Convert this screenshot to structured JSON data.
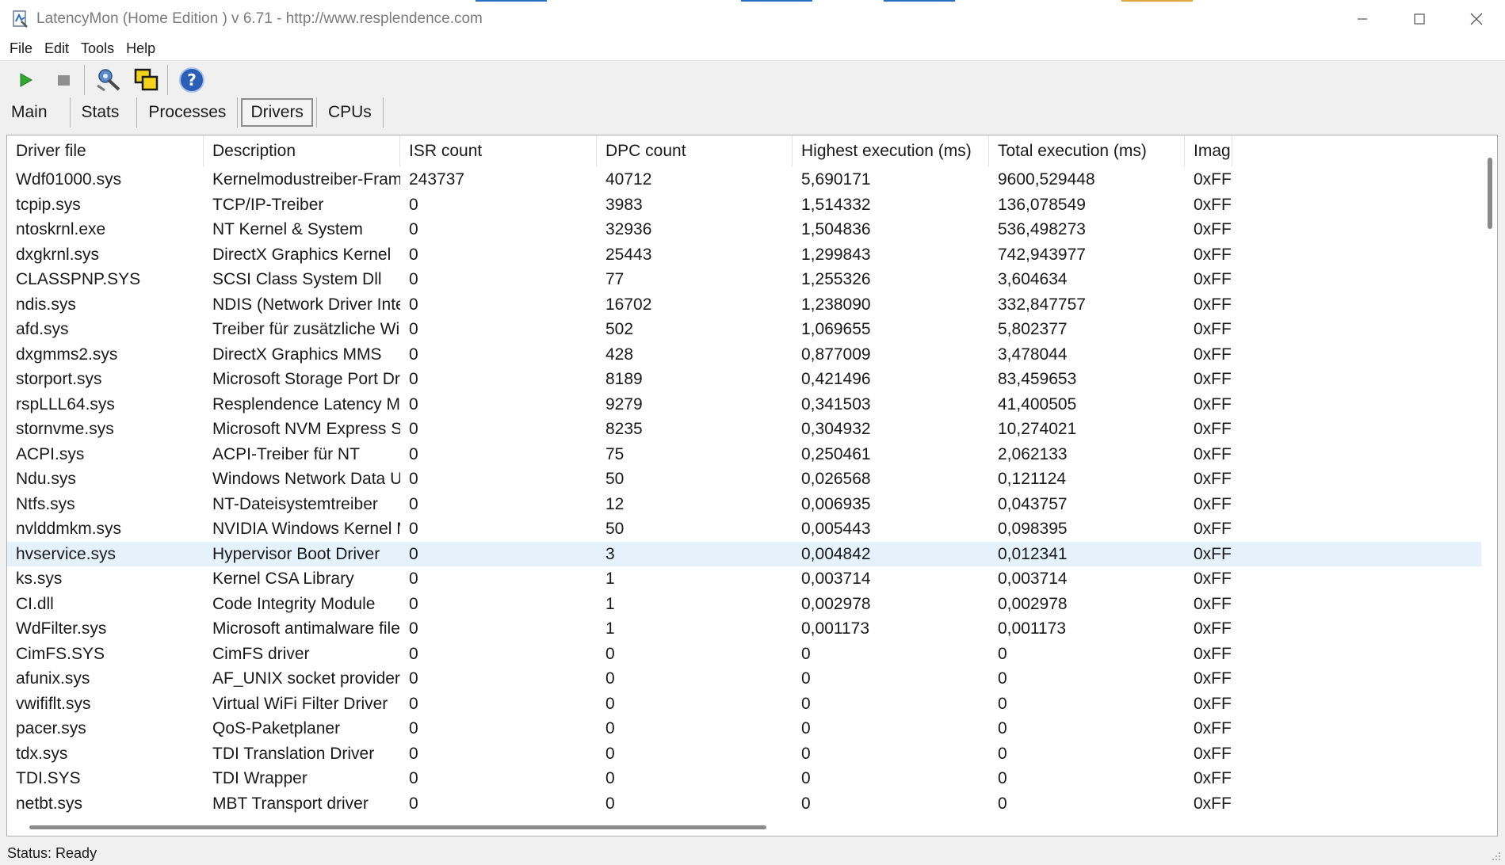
{
  "window": {
    "title": "LatencyMon  (Home Edition )  v 6.71 - http://www.resplendence.com"
  },
  "menu": [
    {
      "label": "File"
    },
    {
      "label": "Edit"
    },
    {
      "label": "Tools"
    },
    {
      "label": "Help"
    }
  ],
  "toolbar": {
    "buttons": [
      "play-icon",
      "stop-icon",
      "settings-wrench-icon",
      "window-overlap-icon",
      "help-icon"
    ]
  },
  "tabs": [
    {
      "label": "Main",
      "active": false
    },
    {
      "label": "Stats",
      "active": false
    },
    {
      "label": "Processes",
      "active": false
    },
    {
      "label": "Drivers",
      "active": true
    },
    {
      "label": "CPUs",
      "active": false
    }
  ],
  "table": {
    "columns": [
      "Driver file",
      "Description",
      "ISR count",
      "DPC count",
      "Highest execution (ms)",
      "Total execution (ms)",
      "Imag"
    ],
    "rows": [
      [
        "Wdf01000.sys",
        "Kernelmodustreiber-Framew...",
        "243737",
        "40712",
        "5,690171",
        "9600,529448",
        "0xFF"
      ],
      [
        "tcpip.sys",
        "TCP/IP-Treiber",
        "0",
        "3983",
        "1,514332",
        "136,078549",
        "0xFF"
      ],
      [
        "ntoskrnl.exe",
        "NT Kernel & System",
        "0",
        "32936",
        "1,504836",
        "536,498273",
        "0xFF"
      ],
      [
        "dxgkrnl.sys",
        "DirectX Graphics Kernel",
        "0",
        "25443",
        "1,299843",
        "742,943977",
        "0xFF"
      ],
      [
        "CLASSPNP.SYS",
        "SCSI Class System Dll",
        "0",
        "77",
        "1,255326",
        "3,604634",
        "0xFF"
      ],
      [
        "ndis.sys",
        "NDIS (Network Driver Interf...",
        "0",
        "16702",
        "1,238090",
        "332,847757",
        "0xFF"
      ],
      [
        "afd.sys",
        "Treiber für zusätzliche WinS...",
        "0",
        "502",
        "1,069655",
        "5,802377",
        "0xFF"
      ],
      [
        "dxgmms2.sys",
        "DirectX Graphics MMS",
        "0",
        "428",
        "0,877009",
        "3,478044",
        "0xFF"
      ],
      [
        "storport.sys",
        "Microsoft Storage Port Driver",
        "0",
        "8189",
        "0,421496",
        "83,459653",
        "0xFF"
      ],
      [
        "rspLLL64.sys",
        "Resplendence Latency Monit...",
        "0",
        "9279",
        "0,341503",
        "41,400505",
        "0xFF"
      ],
      [
        "stornvme.sys",
        "Microsoft NVM Express Stor...",
        "0",
        "8235",
        "0,304932",
        "10,274021",
        "0xFF"
      ],
      [
        "ACPI.sys",
        "ACPI-Treiber für NT",
        "0",
        "75",
        "0,250461",
        "2,062133",
        "0xFF"
      ],
      [
        "Ndu.sys",
        "Windows Network Data Usa...",
        "0",
        "50",
        "0,026568",
        "0,121124",
        "0xFF"
      ],
      [
        "Ntfs.sys",
        "NT-Dateisystemtreiber",
        "0",
        "12",
        "0,006935",
        "0,043757",
        "0xFF"
      ],
      [
        "nvlddmkm.sys",
        "NVIDIA Windows Kernel Mod...",
        "0",
        "50",
        "0,005443",
        "0,098395",
        "0xFF"
      ],
      [
        "hvservice.sys",
        "Hypervisor Boot Driver",
        "0",
        "3",
        "0,004842",
        "0,012341",
        "0xFF"
      ],
      [
        "ks.sys",
        "Kernel CSA Library",
        "0",
        "1",
        "0,003714",
        "0,003714",
        "0xFF"
      ],
      [
        "CI.dll",
        "Code Integrity Module",
        "0",
        "1",
        "0,002978",
        "0,002978",
        "0xFF"
      ],
      [
        "WdFilter.sys",
        "Microsoft antimalware file sys...",
        "0",
        "1",
        "0,001173",
        "0,001173",
        "0xFF"
      ],
      [
        "CimFS.SYS",
        "CimFS driver",
        "0",
        "0",
        "0",
        "0",
        "0xFF"
      ],
      [
        "afunix.sys",
        "AF_UNIX socket provider",
        "0",
        "0",
        "0",
        "0",
        "0xFF"
      ],
      [
        "vwififlt.sys",
        "Virtual WiFi Filter Driver",
        "0",
        "0",
        "0",
        "0",
        "0xFF"
      ],
      [
        "pacer.sys",
        "QoS-Paketplaner",
        "0",
        "0",
        "0",
        "0",
        "0xFF"
      ],
      [
        "tdx.sys",
        "TDI Translation Driver",
        "0",
        "0",
        "0",
        "0",
        "0xFF"
      ],
      [
        "TDI.SYS",
        "TDI Wrapper",
        "0",
        "0",
        "0",
        "0",
        "0xFF"
      ],
      [
        "netbt.sys",
        "MBT Transport driver",
        "0",
        "0",
        "0",
        "0",
        "0xFF"
      ]
    ],
    "selected_row": 15
  },
  "status": {
    "text": "Status: Ready"
  },
  "colors": {
    "selection": "#e5f1fb",
    "play_green": "#2fa82f",
    "help_blue": "#2a5fb8"
  }
}
